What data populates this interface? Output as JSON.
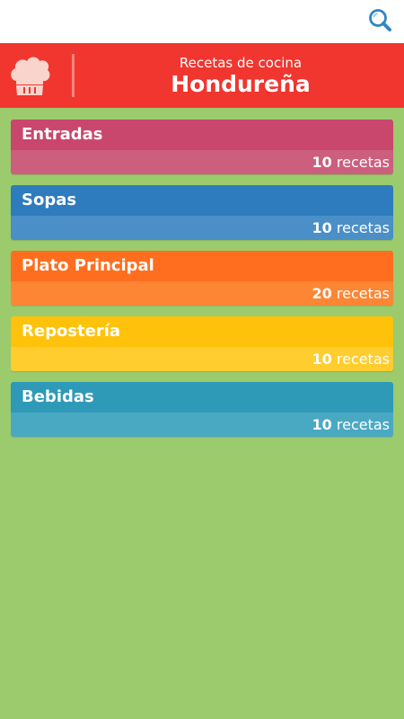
{
  "app": {
    "subtitle": "Recetas de cocina",
    "title": "Hondureña",
    "logo_icon": "chef-hat-icon",
    "search_icon": "search-icon",
    "accent_color": "#f0362f",
    "background_color": "#9ccb6e"
  },
  "categories": [
    {
      "name": "Entradas",
      "count": "10",
      "unit": "recetas",
      "color_top": "#c9476d",
      "color_bottom": "#cc5f7d"
    },
    {
      "name": "Sopas",
      "count": "10",
      "unit": "recetas",
      "color_top": "#2e7bbd",
      "color_bottom": "#4a8fc7"
    },
    {
      "name": "Plato Principal",
      "count": "20",
      "unit": "recetas",
      "color_top": "#ff6e1e",
      "color_bottom": "#fd8634"
    },
    {
      "name": "Repostería",
      "count": "10",
      "unit": "recetas",
      "color_top": "#ffc20b",
      "color_bottom": "#ffcd2e"
    },
    {
      "name": "Bebidas",
      "count": "10",
      "unit": "recetas",
      "color_top": "#2e9ab7",
      "color_bottom": "#4aa9c2"
    }
  ]
}
